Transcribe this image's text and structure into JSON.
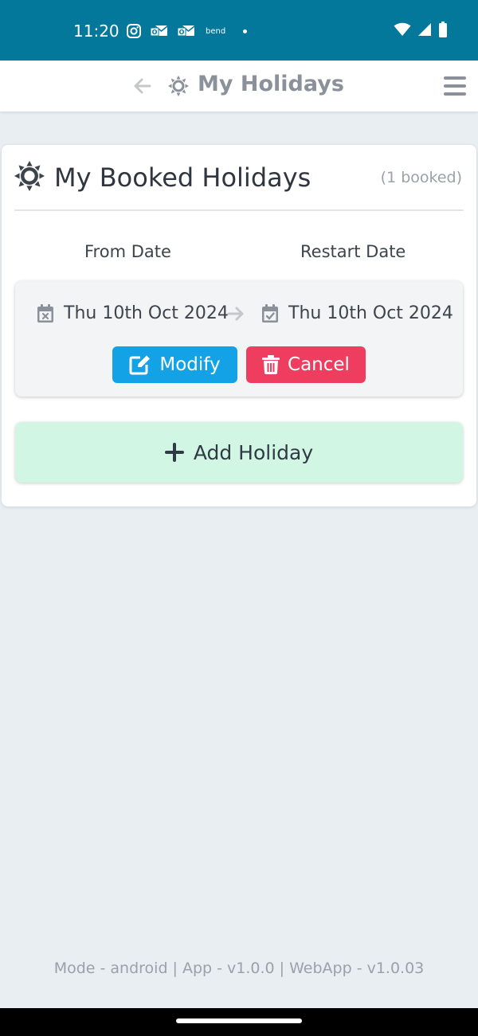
{
  "status_bar": {
    "time": "11:20",
    "notification_text": "bend",
    "icons": [
      "instagram-icon",
      "outlook-icon",
      "outlook-icon",
      "wifi-icon",
      "signal-icon",
      "battery-icon"
    ]
  },
  "header": {
    "title": "My Holidays",
    "back_icon": "arrow-left-icon",
    "title_icon": "sun-gear-icon",
    "menu_icon": "hamburger-icon"
  },
  "card": {
    "title": "My Booked Holidays",
    "count": "(1 booked)",
    "columns": {
      "from": "From Date",
      "restart": "Restart Date"
    },
    "holidays": [
      {
        "from_date": "Thu 10th Oct 2024",
        "restart_date": "Thu 10th Oct 2024",
        "modify_label": "Modify",
        "cancel_label": "Cancel"
      }
    ],
    "add_label": "Add Holiday"
  },
  "footer": "Mode - android | App - v1.0.0 | WebApp - v1.0.03",
  "colors": {
    "status_bar": "#03789a",
    "modify": "#14a2e6",
    "cancel": "#ee3d5f",
    "add": "#d2f6e4",
    "background": "#e8eef2"
  }
}
